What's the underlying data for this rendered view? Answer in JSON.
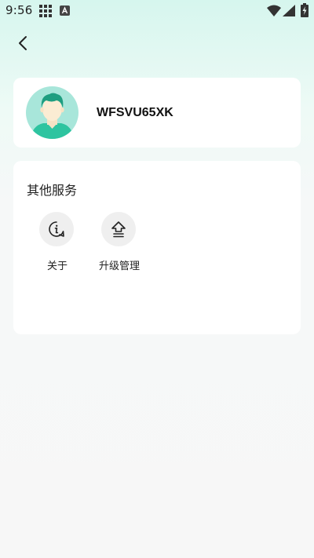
{
  "status_bar": {
    "time": "9:56",
    "icons": [
      "grid-icon",
      "a-icon",
      "wifi-icon",
      "signal-icon",
      "battery-charging-icon"
    ]
  },
  "nav": {
    "back_icon": "chevron-left-icon"
  },
  "profile": {
    "username": "WFSVU65XK",
    "avatar_icon": "user-avatar-icon"
  },
  "services": {
    "title": "其他服务",
    "items": [
      {
        "label": "关于",
        "icon": "info-icon"
      },
      {
        "label": "升级管理",
        "icon": "upgrade-icon"
      }
    ]
  },
  "colors": {
    "accent": "#2ec4a0",
    "avatar_bg": "#a8e6da",
    "background_top": "#d6f6ee",
    "card": "#ffffff",
    "icon_circle": "#efefef"
  }
}
